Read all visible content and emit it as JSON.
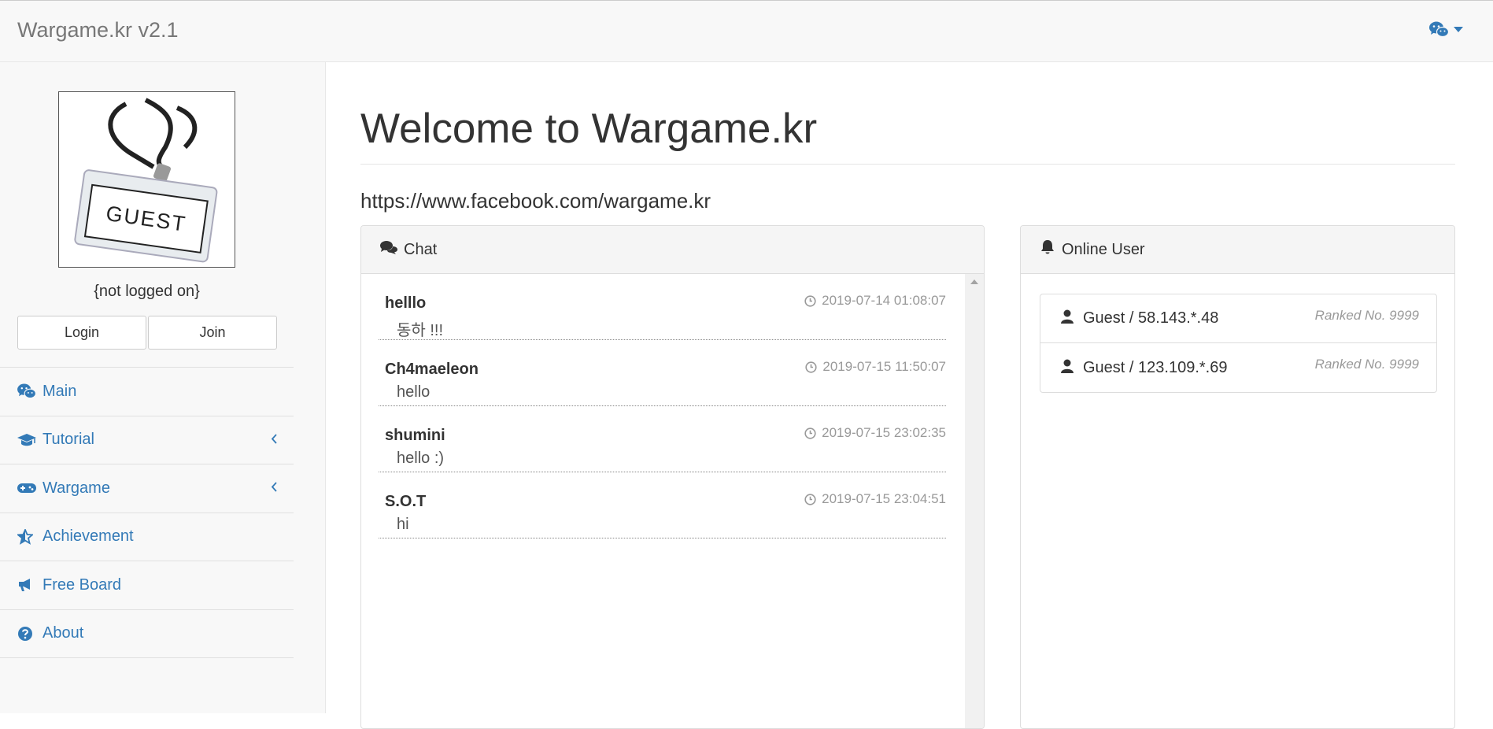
{
  "header": {
    "brand": "Wargame.kr v2.1",
    "menu_icon": "wechat-icon"
  },
  "sidebar": {
    "avatar_alt": "GUEST",
    "login_state": "{not logged on}",
    "login_label": "Login",
    "join_label": "Join",
    "nav": [
      {
        "label": "Main",
        "icon": "wechat-icon",
        "submenu": false
      },
      {
        "label": "Tutorial",
        "icon": "graduation-cap-icon",
        "submenu": true
      },
      {
        "label": "Wargame",
        "icon": "gamepad-icon",
        "submenu": true
      },
      {
        "label": "Achievement",
        "icon": "star-half-icon",
        "submenu": false
      },
      {
        "label": "Free Board",
        "icon": "bullhorn-icon",
        "submenu": false
      },
      {
        "label": "About",
        "icon": "question-circle-icon",
        "submenu": false
      }
    ]
  },
  "main": {
    "headline": "Welcome to Wargame.kr",
    "link": "https://www.facebook.com/wargame.kr",
    "chat": {
      "title": "Chat",
      "messages": [
        {
          "user": "helllo",
          "time": "2019-07-14 01:08:07",
          "text": "동하 !!!"
        },
        {
          "user": "Ch4maeleon",
          "time": "2019-07-15 11:50:07",
          "text": "hello"
        },
        {
          "user": "shumini",
          "time": "2019-07-15 23:02:35",
          "text": "hello :)"
        },
        {
          "user": "S.O.T",
          "time": "2019-07-15 23:04:51",
          "text": "hi"
        }
      ]
    },
    "online": {
      "title": "Online User",
      "users": [
        {
          "name": "Guest / 58.143.*.48",
          "rank": "Ranked No. 9999"
        },
        {
          "name": "Guest / 123.109.*.69",
          "rank": "Ranked No. 9999"
        }
      ]
    }
  },
  "colors": {
    "link": "#337ab7",
    "navbar_bg": "#f8f8f8",
    "muted": "#999999"
  }
}
